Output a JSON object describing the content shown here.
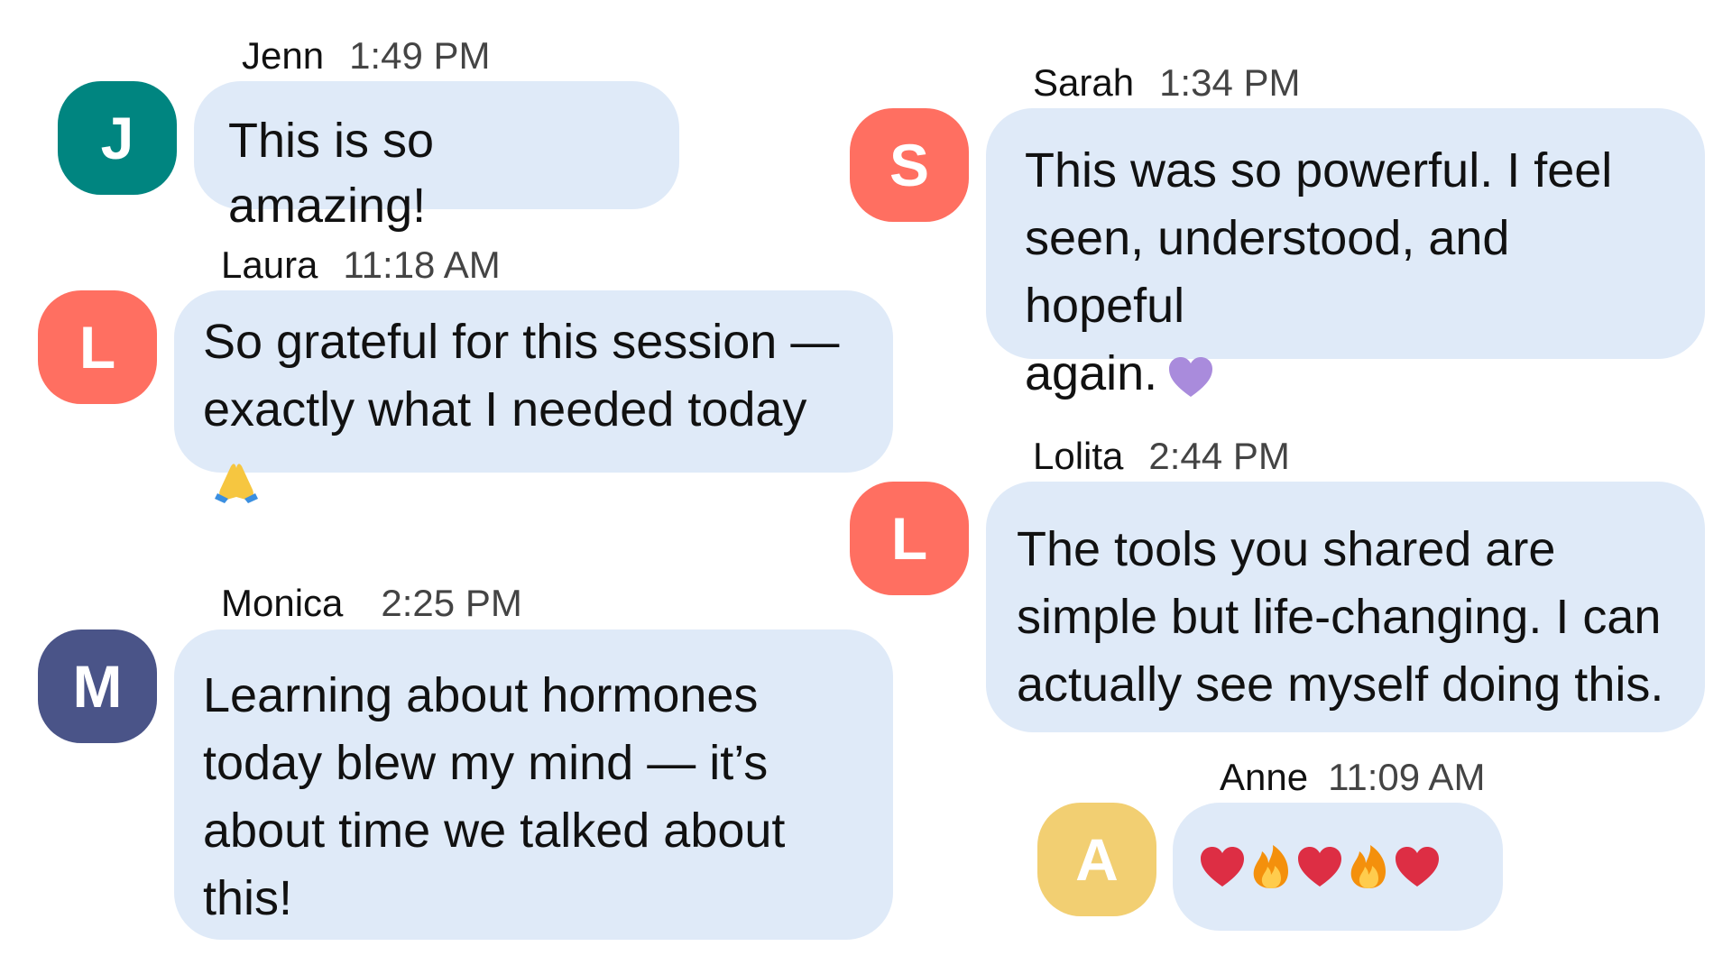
{
  "messages": [
    {
      "name": "Jenn",
      "time": "1:49 PM",
      "initial": "J",
      "avatar_color": "#008580",
      "lines": [
        "This is so amazing!"
      ]
    },
    {
      "name": "Laura",
      "time": "11:18 AM",
      "initial": "L",
      "avatar_color": "#ff6f61",
      "lines": [
        "So grateful for this session —",
        "exactly what I needed today"
      ],
      "trailing_icon": "folded-hands-icon"
    },
    {
      "name": "Monica",
      "time": "2:25 PM",
      "initial": "M",
      "avatar_color": "#4a5488",
      "lines": [
        "Learning about hormones",
        "today blew my mind — it’s",
        "about time we talked about",
        "this!"
      ]
    },
    {
      "name": "Sarah",
      "time": "1:34 PM",
      "initial": "S",
      "avatar_color": "#ff6f61",
      "lines": [
        "This was so powerful. I feel",
        "seen, understood, and hopeful",
        "again."
      ],
      "trailing_icon": "purple-heart-icon"
    },
    {
      "name": "Lolita",
      "time": "2:44 PM",
      "initial": "L",
      "avatar_color": "#ff6f61",
      "lines": [
        "The tools you shared are",
        "simple but life-changing. I can",
        "actually see myself doing this."
      ]
    },
    {
      "name": "Anne",
      "time": "11:09 AM",
      "initial": "A",
      "avatar_color": "#f2cf72",
      "emoji_sequence": [
        "red-heart-icon",
        "fire-icon",
        "red-heart-icon",
        "fire-icon",
        "red-heart-icon"
      ]
    }
  ]
}
